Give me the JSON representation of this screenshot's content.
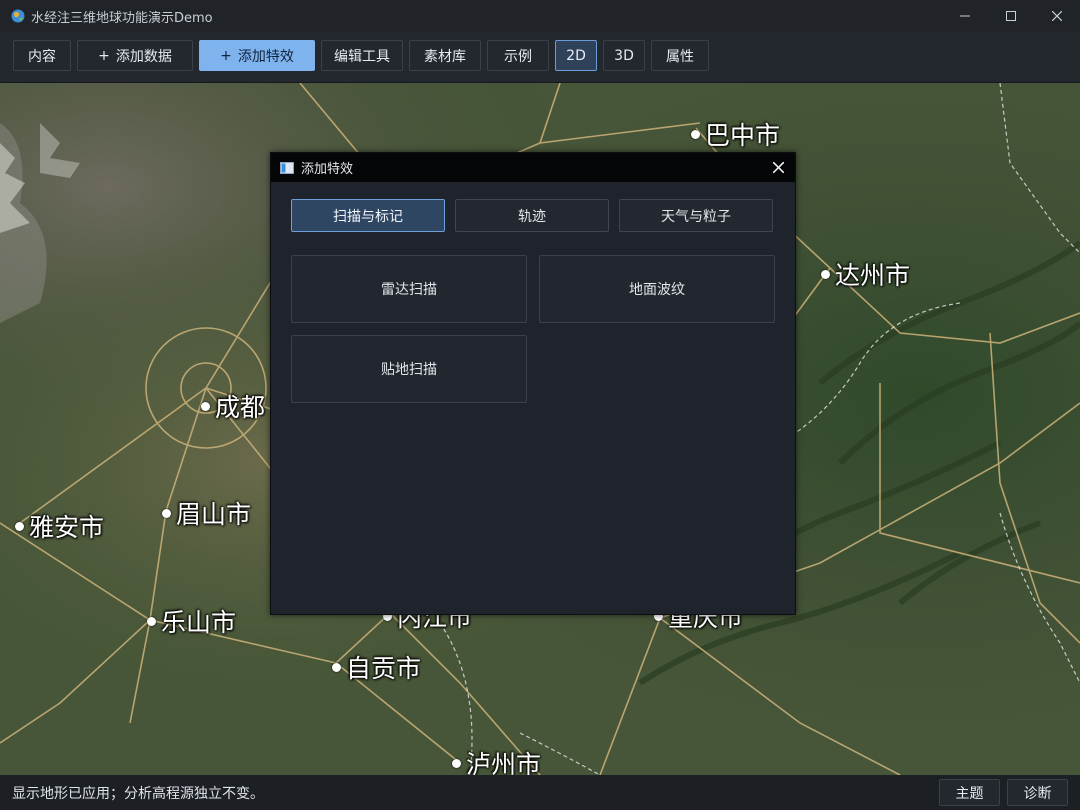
{
  "window": {
    "title": "水经注三维地球功能演示Demo"
  },
  "toolbar": {
    "content": "内容",
    "add_data": "添加数据",
    "add_effect": "添加特效",
    "edit_tools": "编辑工具",
    "materials": "素材库",
    "examples": "示例",
    "view_2d": "2D",
    "view_3d": "3D",
    "properties": "属性",
    "plus": "+"
  },
  "map": {
    "cities": {
      "bazhong": "巴中市",
      "dazhou": "达州市",
      "chengdu": "成都",
      "yaan": "雅安市",
      "meishan": "眉山市",
      "leshan": "乐山市",
      "neijiang": "内江市",
      "chongqing": "重庆市",
      "zigong": "自贡市",
      "luzhou": "泸州市"
    }
  },
  "dialog": {
    "title": "添加特效",
    "tabs": [
      "扫描与标记",
      "轨迹",
      "天气与粒子"
    ],
    "active_tab": "扫描与标记",
    "items": [
      "雷达扫描",
      "地面波纹",
      "贴地扫描"
    ]
  },
  "statusbar": {
    "message": "显示地形已应用；分析高程源独立不变。",
    "theme": "主题",
    "diagnose": "诊断"
  },
  "colors": {
    "accent": "#7fb3ee",
    "active_tab": "#2f4663",
    "dialog_bg": "#1f232b",
    "toolbar_bg": "#23272e"
  }
}
